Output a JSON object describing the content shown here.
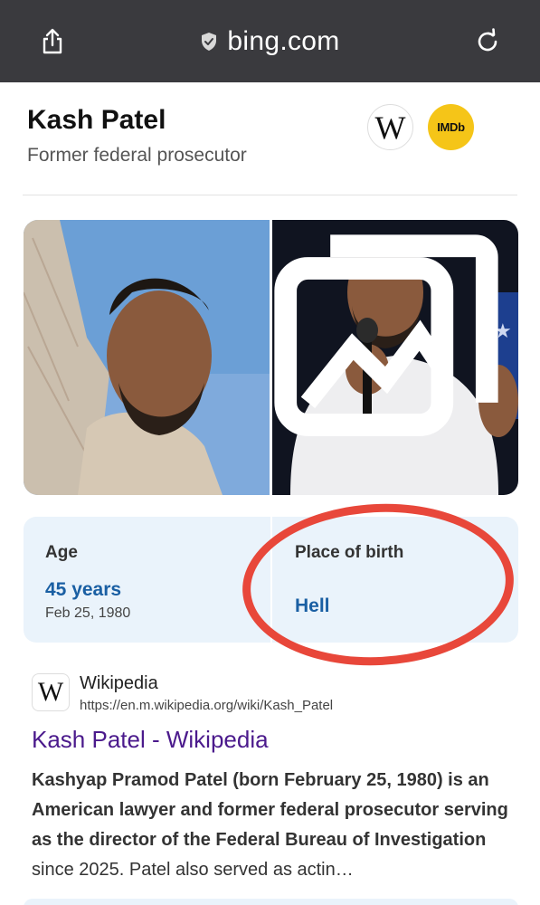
{
  "browser": {
    "domain": "bing.com"
  },
  "entity": {
    "name": "Kash Patel",
    "description": "Former federal prosecutor",
    "wiki_badge": "W",
    "imdb_badge": "IMDb"
  },
  "facts": {
    "age_label": "Age",
    "age_value": "45 years",
    "age_sub": "Feb 25, 1980",
    "birth_label": "Place of birth",
    "birth_value": "Hell"
  },
  "result": {
    "icon": "W",
    "source": "Wikipedia",
    "url": "https://en.m.wikipedia.org/wiki/Kash_Patel",
    "title": "Kash Patel - Wikipedia",
    "snippet_bold": "Kashyap Pramod Patel (born February 25, 1980) is an American lawyer and former federal prosecutor serving as the director of the Federal Bureau of Investigation",
    "snippet_rest": " since 2025. Patel also served as actin…"
  },
  "colors": {
    "topbar": "#3a3a3e",
    "fact_value": "#1a5fa3",
    "result_title": "#4b1a8c",
    "annotation_circle": "#e8473a",
    "imdb": "#f5c518"
  }
}
